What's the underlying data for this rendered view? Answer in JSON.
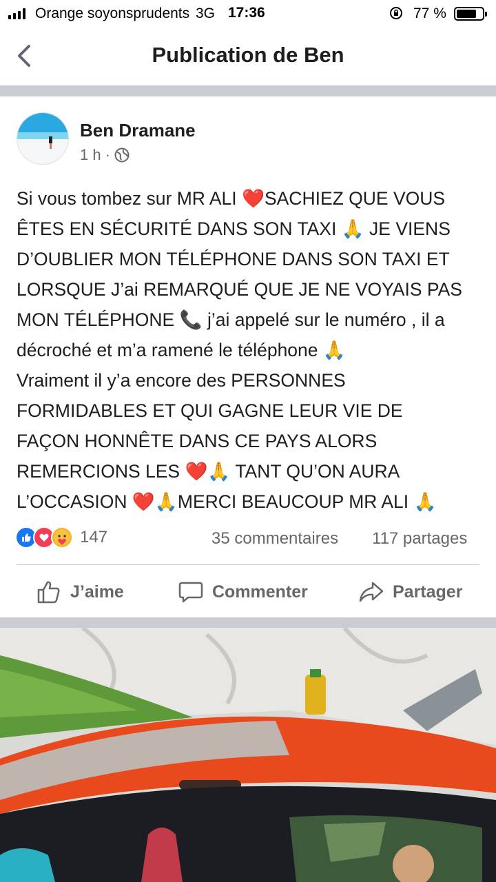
{
  "status_bar": {
    "carrier": "Orange soyonsprudents",
    "network": "3G",
    "time": "17:36",
    "battery": "77 %",
    "battery_level": 0.77
  },
  "header": {
    "title": "Publication de Ben"
  },
  "post": {
    "author": "Ben Dramane",
    "time": "1 h",
    "separator": "·",
    "text_lines": [
      "Si vous tombez sur MR ALI ❤️SACHIEZ QUE VOUS",
      "ÊTES EN SÉCURITÉ DANS SON TAXI 🙏 JE VIENS",
      "D’OUBLIER MON TÉLÉPHONE DANS SON TAXI ET",
      "LORSQUE J’ai REMARQUÉ QUE JE NE VOYAIS PAS",
      "MON TÉLÉPHONE 📞 j’ai appelé sur le numéro , il a",
      "décroché et m’a ramené le téléphone 🙏",
      "Vraiment il y’a encore des PERSONNES",
      "FORMIDABLES ET QUI GAGNE LEUR VIE DE",
      "FAÇON HONNÊTE DANS CE PAYS ALORS",
      "REMERCIONS LES ❤️🙏 TANT QU’ON AURA",
      "L’OCCASION ❤️🙏MERCI BEAUCOUP MR ALI 🙏"
    ],
    "reactions_count": "147",
    "comments": "35 commentaires",
    "shares": "117 partages"
  },
  "actions": {
    "like": "J’aime",
    "comment": "Commenter",
    "share": "Partager"
  },
  "icons": [
    "signal-icon",
    "rotation-lock-icon",
    "battery-icon",
    "back-arrow-icon",
    "globe-icon",
    "like-reaction-icon",
    "love-reaction-icon",
    "care-reaction-icon",
    "thumbs-up-icon",
    "comment-bubble-icon",
    "share-arrow-icon"
  ],
  "colors": {
    "accent": "#1877f2",
    "love": "#f33e58",
    "taxi_orange": "#e84a1e",
    "text_secondary": "#65676b"
  }
}
